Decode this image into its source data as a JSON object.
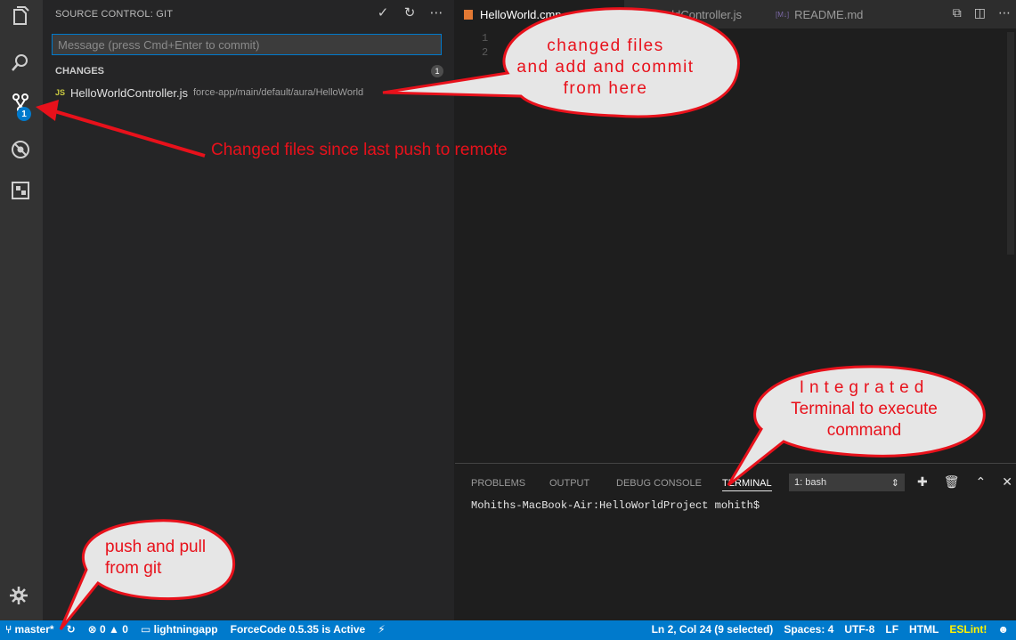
{
  "sidebar": {
    "title": "SOURCE CONTROL: GIT",
    "commit_placeholder": "Message (press Cmd+Enter to commit)",
    "changes_header": "CHANGES",
    "changes_count": "1",
    "change": {
      "icon_label": "JS",
      "file": "HelloWorldController.js",
      "path": "force-app/main/default/aura/HelloWorld"
    },
    "scm_badge": "1"
  },
  "editor": {
    "tabs": [
      {
        "label": "HelloWorld.cmp"
      },
      {
        "label": "HelloWorldController.js"
      },
      {
        "label": "README.md"
      }
    ],
    "line_numbers": [
      "1",
      "2"
    ]
  },
  "panel": {
    "tabs": [
      "PROBLEMS",
      "OUTPUT",
      "DEBUG CONSOLE",
      "TERMINAL"
    ],
    "terminal_select": "1: bash",
    "terminal_prompt": "Mohiths-MacBook-Air:HelloWorldProject mohith$"
  },
  "statusbar": {
    "branch": "master*",
    "errors": "0",
    "warnings": "0",
    "project": "lightningapp",
    "forcecode": "ForceCode 0.5.35 is Active",
    "position": "Ln 2, Col 24 (9 selected)",
    "spaces": "Spaces: 4",
    "encoding": "UTF-8",
    "eol": "LF",
    "language": "HTML",
    "eslint": "ESLint!"
  },
  "annotations": {
    "changed_files_bubble": [
      "changed files",
      "and add and commit",
      "from here"
    ],
    "changed_caption": "Changed files since last push to remote",
    "terminal_bubble": [
      "Integrated",
      "Terminal to execute",
      "command"
    ],
    "push_bubble": [
      "push and pull",
      "from git"
    ]
  },
  "colors": {
    "accent": "#007acc",
    "annotation_red": "#e8111b",
    "bubble_fill": "#e6e6e6"
  }
}
